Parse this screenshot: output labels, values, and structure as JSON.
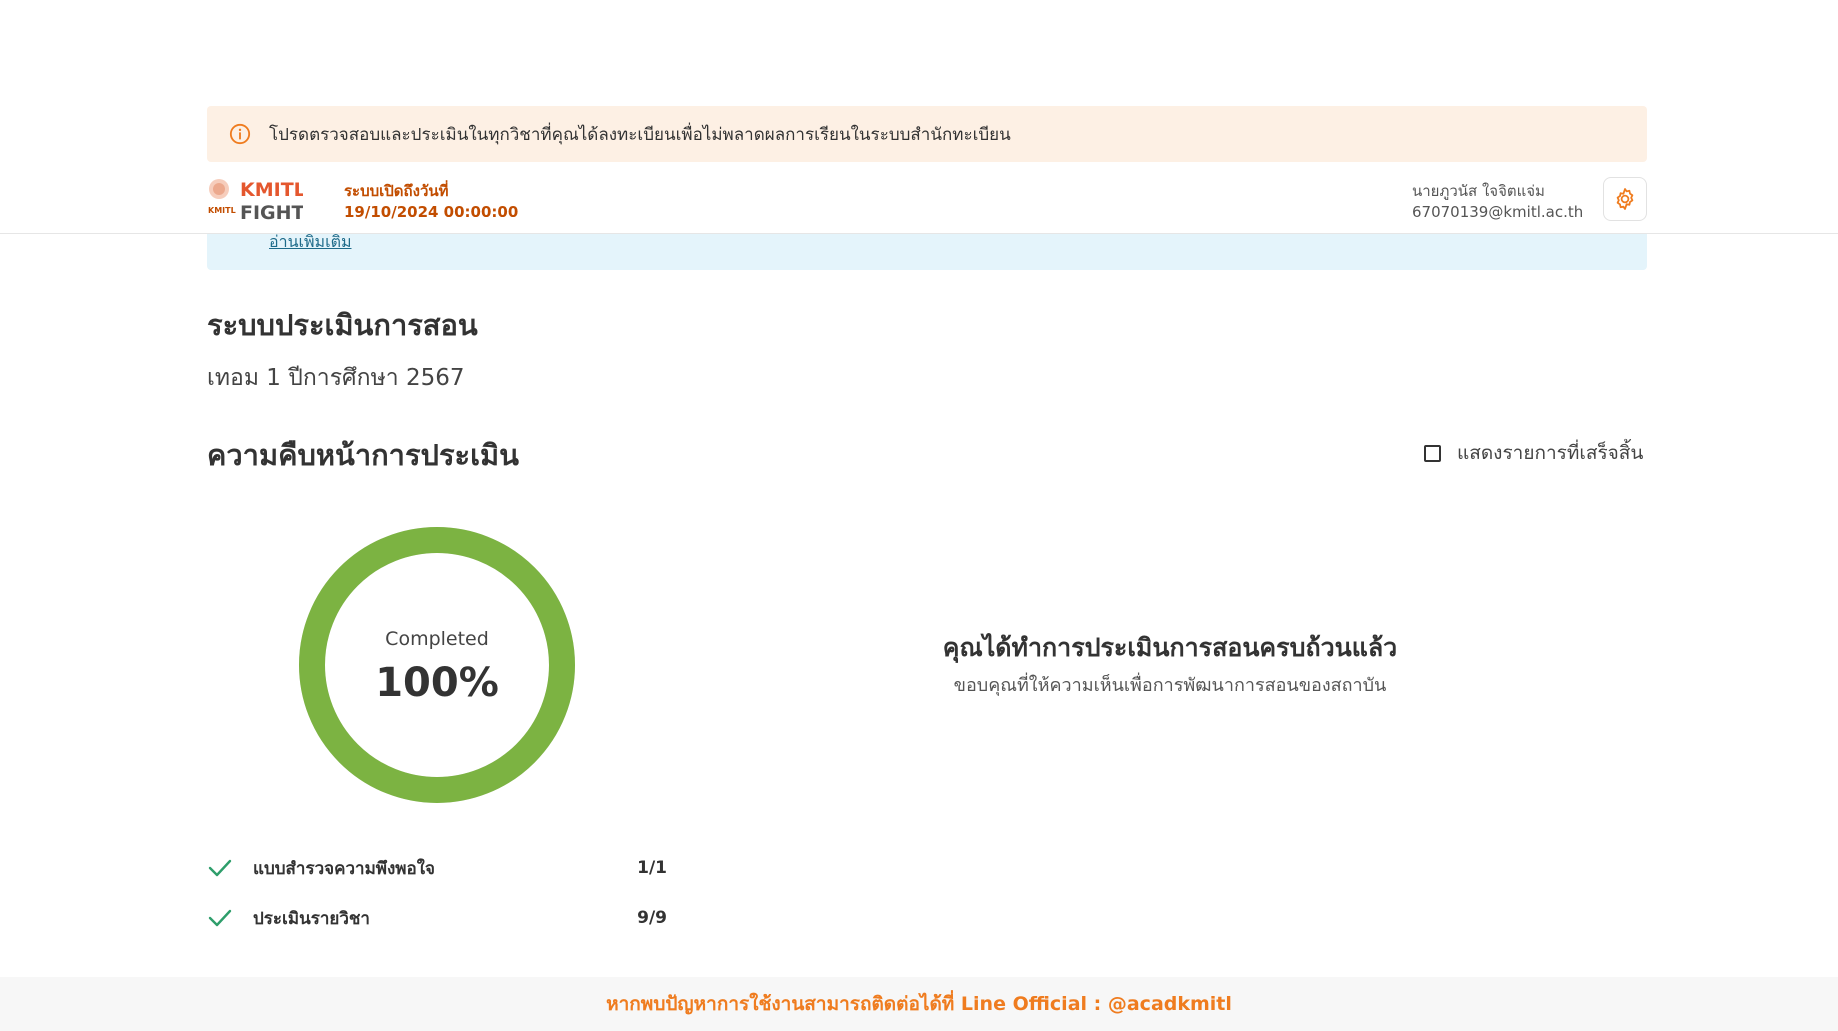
{
  "warning_banner": {
    "icon": "info-circle-icon",
    "text": "โปรดตรวจสอบและประเมินในทุกวิชาที่คุณได้ลงทะเบียนเพื่อไม่พลาดผลการเรียนในระบบสำนักทะเบียน",
    "color": "#ef7c1f"
  },
  "info_banner": {
    "link_text": "อ่านเพิ่มเติม"
  },
  "header": {
    "logo_text_top": "KMITL",
    "logo_text_bottom": "FIGHT",
    "open_label": "ระบบเปิดถึงวันที่",
    "open_date": "19/10/2024 00:00:00",
    "user_name": "นายภูวนัส ใจจิตแจ่ม",
    "user_email": "67070139@kmitl.ac.th",
    "settings_icon": "gear-icon"
  },
  "main": {
    "title": "ระบบประเมินการสอน",
    "term": "เทอม 1 ปีการศึกษา 2567",
    "progress_title": "ความคืบหน้าการประเมิน",
    "show_completed_label": "แสดงรายการที่เสร็จสิ้น",
    "show_completed_checked": false
  },
  "progress": {
    "label": "Completed",
    "percent_text": "100%",
    "percent_value": 100,
    "color": "#7cb342"
  },
  "completion": {
    "title": "คุณได้ทำการประเมินการสอนครบถ้วนแล้ว",
    "subtitle": "ขอบคุณที่ให้ความเห็นเพื่อการพัฒนาการสอนของสถาบัน"
  },
  "items": [
    {
      "label": "แบบสำรวจความพึงพอใจ",
      "count": "1/1",
      "done": true
    },
    {
      "label": "ประเมินรายวิชา",
      "count": "9/9",
      "done": true
    }
  ],
  "footer": {
    "text": "หากพบปัญหาการใช้งานสามารถติดต่อได้ที่ Line Official : @acadkmitl"
  }
}
